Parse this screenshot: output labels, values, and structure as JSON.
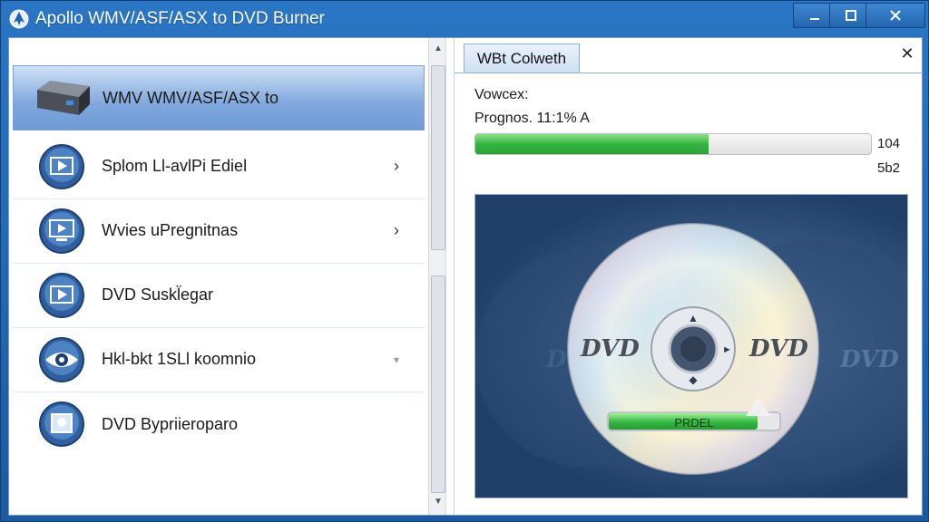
{
  "window": {
    "title": "Apollo WMV/ASF/ASX to DVD Burner",
    "min_glyph": "—",
    "max_glyph": "☐",
    "close_glyph": "✕"
  },
  "sidebar": {
    "items": [
      {
        "label": "WMV WMV/ASF/ASX to",
        "icon": "dvd-drive-icon",
        "selected": true,
        "chevron": ""
      },
      {
        "label": "Splom Ll-avlPi Ediel",
        "icon": "play-screen-icon",
        "selected": false,
        "chevron": "›"
      },
      {
        "label": "Wvies uPregnitnas",
        "icon": "monitor-play-icon",
        "selected": false,
        "chevron": "›"
      },
      {
        "label": "DVD Suskl̈egar",
        "icon": "play-screen-icon",
        "selected": false,
        "chevron": ""
      },
      {
        "label": "Hkl-bkt 1SLl koomnio",
        "icon": "eye-icon",
        "selected": false,
        "chevron": "▾"
      },
      {
        "label": "DVD Bypriieroparo",
        "icon": "image-icon",
        "selected": false,
        "chevron": ""
      }
    ]
  },
  "right_panel": {
    "tab_label": "WBt Colweth",
    "close_glyph": "✕",
    "status_title": "Vowcex:",
    "progress_text": "Prognos. 11:1% A",
    "progress_fraction": 0.59,
    "side_value_1": "104",
    "side_value_2": "5b2",
    "disc": {
      "left_label": "DVD",
      "right_label": "DVD",
      "bar_label": "PRDEL",
      "bar_fraction": 0.87,
      "bg_left_label": "DVD",
      "bg_right_label": "DVD"
    }
  },
  "colors": {
    "accent": "#2a76c4",
    "progress_green": "#33b540"
  }
}
